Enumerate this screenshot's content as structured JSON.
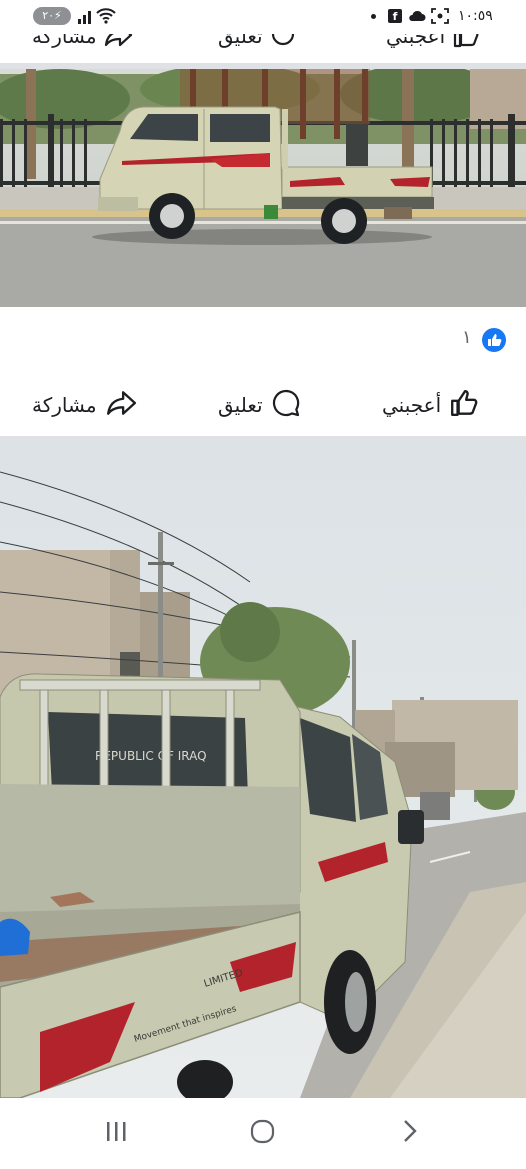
{
  "status_bar": {
    "time": "١٠:٥٩",
    "battery": "٢٠",
    "icons": [
      "dot-icon",
      "facebook-icon",
      "cloud-icon",
      "screenshot-icon",
      "signal-icon",
      "wifi-icon",
      "battery-icon"
    ]
  },
  "previous_post_actions": {
    "like_label": "أعجبني",
    "comment_label": "تعليق",
    "share_label": "مشاركة"
  },
  "post": {
    "photo1_alt": "",
    "reactions": {
      "count": "١",
      "icon": "like-reaction-icon"
    },
    "actions": {
      "like_label": "أعجبني",
      "comment_label": "تعليق",
      "share_label": "مشاركة"
    },
    "photo2_alt": ""
  },
  "colors": {
    "facebook_blue": "#1877f2",
    "divider": "#dfe1e5",
    "text": "#1c1e21",
    "muted": "#65676b"
  },
  "nav_bar": {
    "buttons": [
      "recent-apps-icon",
      "home-icon",
      "back-icon"
    ]
  }
}
